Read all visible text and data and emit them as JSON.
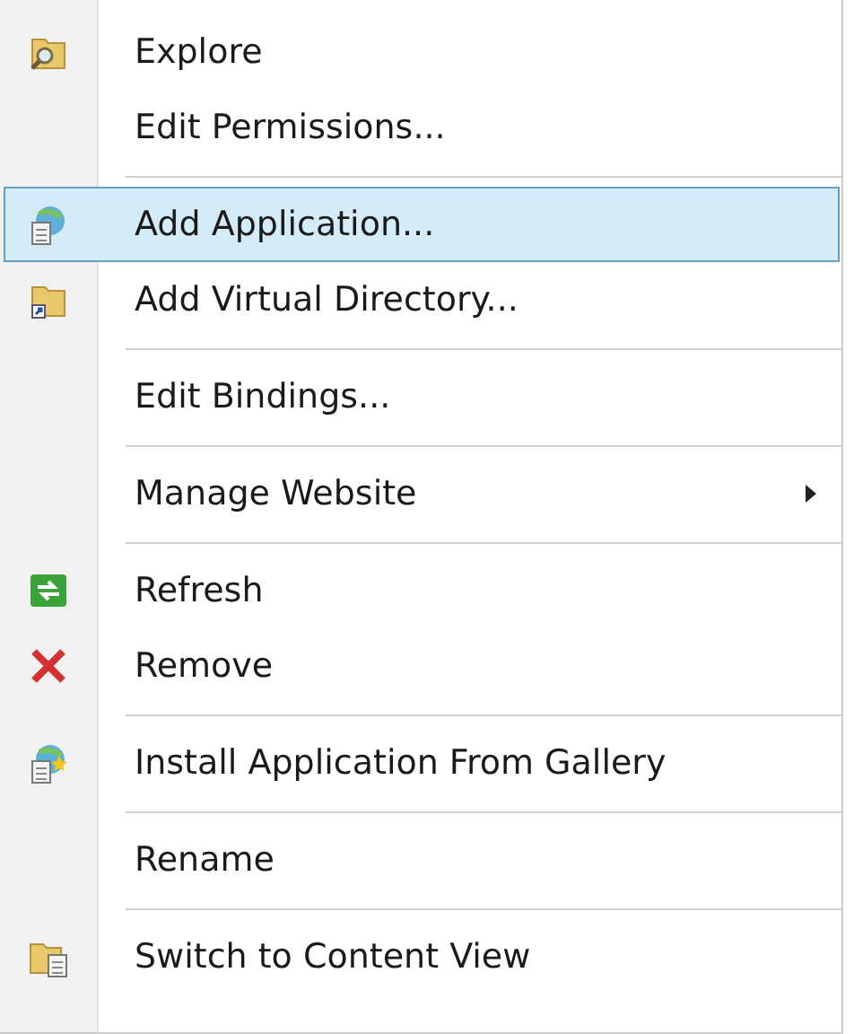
{
  "context_menu": {
    "entries": [
      {
        "kind": "item",
        "label": "Explore",
        "selected": false,
        "submenu": false
      },
      {
        "kind": "item",
        "label": "Edit Permissions...",
        "selected": false,
        "submenu": false
      },
      {
        "kind": "separator"
      },
      {
        "kind": "item",
        "label": "Add Application...",
        "selected": true,
        "submenu": false
      },
      {
        "kind": "item",
        "label": "Add Virtual Directory...",
        "selected": false,
        "submenu": false
      },
      {
        "kind": "separator"
      },
      {
        "kind": "item",
        "label": "Edit Bindings...",
        "selected": false,
        "submenu": false
      },
      {
        "kind": "separator"
      },
      {
        "kind": "item",
        "label": "Manage Website",
        "selected": false,
        "submenu": true
      },
      {
        "kind": "separator"
      },
      {
        "kind": "item",
        "label": "Refresh",
        "selected": false,
        "submenu": false
      },
      {
        "kind": "item",
        "label": "Remove",
        "selected": false,
        "submenu": false
      },
      {
        "kind": "separator"
      },
      {
        "kind": "item",
        "label": "Install Application From Gallery",
        "selected": false,
        "submenu": false
      },
      {
        "kind": "separator"
      },
      {
        "kind": "item",
        "label": "Rename",
        "selected": false,
        "submenu": false
      },
      {
        "kind": "separator"
      },
      {
        "kind": "item",
        "label": "Switch to Content View",
        "selected": false,
        "submenu": false
      }
    ]
  }
}
